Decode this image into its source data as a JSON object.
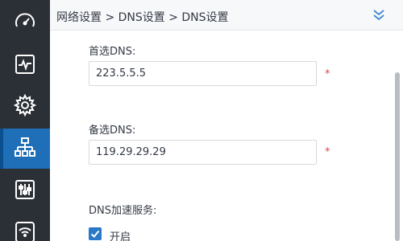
{
  "sidebar": {
    "items": [
      {
        "icon": "speedometer-icon",
        "active": false
      },
      {
        "icon": "pulse-monitor-icon",
        "active": false
      },
      {
        "icon": "gear-icon",
        "active": false
      },
      {
        "icon": "network-topology-icon",
        "active": true
      },
      {
        "icon": "sliders-icon",
        "active": false
      },
      {
        "icon": "wifi-router-icon",
        "active": false
      }
    ]
  },
  "header": {
    "breadcrumb": "网络设置 > DNS设置 > DNS设置",
    "collapse_icon": "double-chevron-down-icon"
  },
  "form": {
    "primary_dns": {
      "label": "首选DNS:",
      "value": "223.5.5.5",
      "required_mark": "*"
    },
    "secondary_dns": {
      "label": "备选DNS:",
      "value": "119.29.29.29",
      "required_mark": "*"
    },
    "acceleration": {
      "label": "DNS加速服务:",
      "option_label": "开启",
      "checked": true
    }
  },
  "colors": {
    "sidebar_bg": "#2b2f36",
    "active_item": "#1f6fb8",
    "icon_stroke": "#ffffff",
    "accent": "#2a78c6",
    "required": "#e0474f"
  }
}
